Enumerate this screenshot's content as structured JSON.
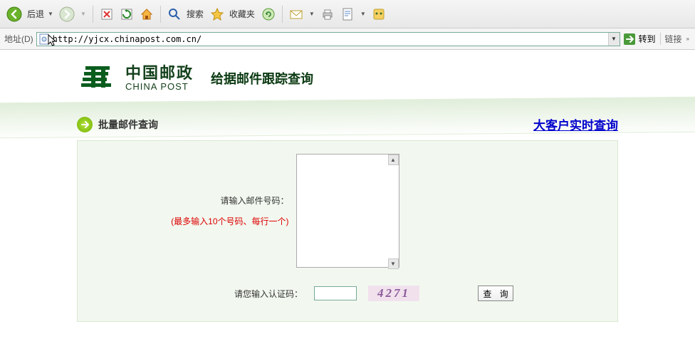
{
  "toolbar": {
    "back_label": "后退",
    "search_label": "搜索",
    "favorites_label": "收藏夹"
  },
  "addrbar": {
    "label": "地址(D)",
    "url": "http://yjcx.chinapost.com.cn/",
    "go_label": "转到",
    "links_label": "链接"
  },
  "logo": {
    "cn": "中国邮政",
    "en": "CHINA POST",
    "tagline": "给据邮件跟踪查询"
  },
  "heading": {
    "batch_label": "批量邮件查询",
    "vip_link": "大客户实时查询"
  },
  "form": {
    "tracking_label": "请输入邮件号码：",
    "tracking_hint": "(最多输入10个号码、每行一个)",
    "captcha_label": "请您输入认证码：",
    "captcha_value": "4271",
    "query_btn": "查 询"
  }
}
